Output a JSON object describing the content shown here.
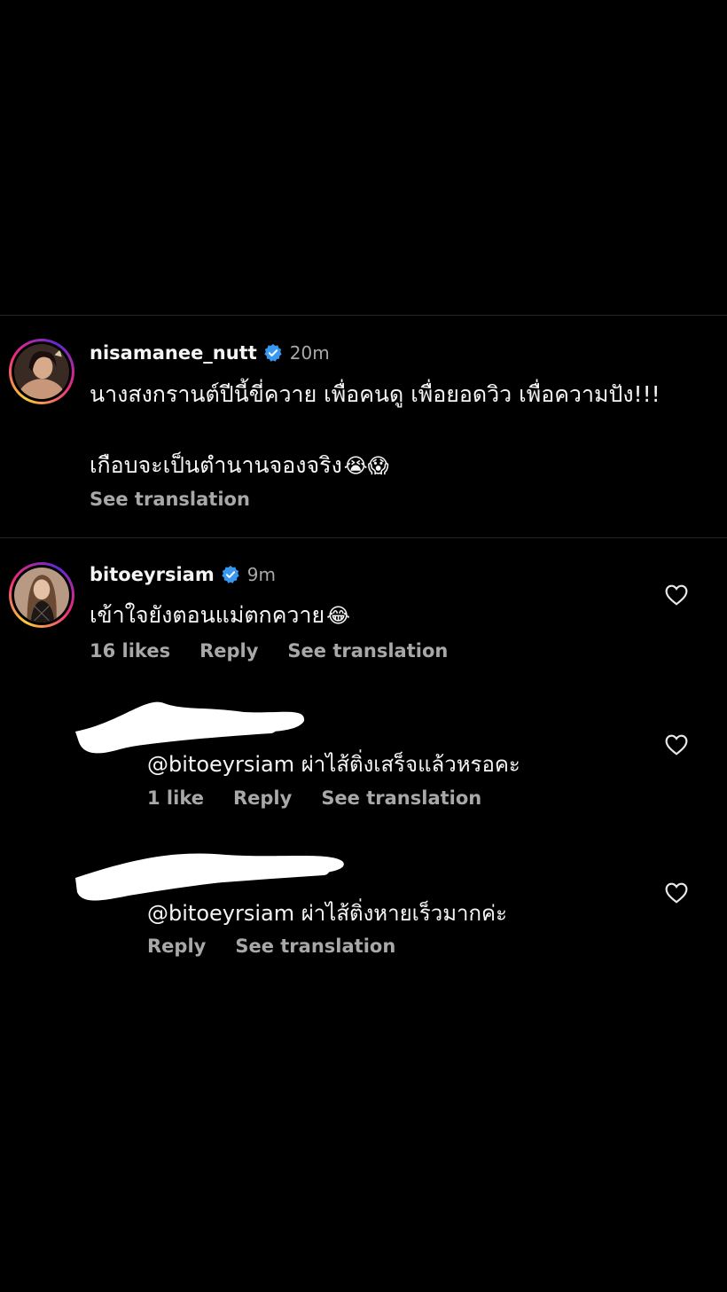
{
  "post_caption": {
    "username": "nisamanee_nutt",
    "verified": true,
    "time": "20m",
    "line1": "นางสงกรานต์ปีนี้ขี่ควาย เพื่อคนดู เพื่อยอดวิว เพื่อความปัง!!!",
    "line2": "เกือบจะเป็นตำนานจองจริง",
    "line2_emojis": "😭😱",
    "see_translation": "See translation"
  },
  "comment": {
    "username": "bitoeyrsiam",
    "verified": true,
    "time": "9m",
    "text": "เข้าใจยังตอนแม่ตกควาย",
    "emoji": "😂",
    "likes": "16 likes",
    "reply": "Reply",
    "see_translation": "See translation"
  },
  "replies": [
    {
      "username_hidden": true,
      "text": "@bitoeyrsiam ผ่าไส้ติ่งเสร็จแล้วหรอคะ",
      "likes": "1 like",
      "reply": "Reply",
      "see_translation": "See translation"
    },
    {
      "username_hidden": true,
      "text": "@bitoeyrsiam ผ่าไส้ติ่งหายเร็วมากค่ะ",
      "reply": "Reply",
      "see_translation": "See translation"
    }
  ],
  "colors": {
    "background": "#000000",
    "primary_text": "#f5f5f5",
    "secondary_text": "#a8a8a8",
    "verified_blue": "#3897f0",
    "divider": "#262626"
  }
}
